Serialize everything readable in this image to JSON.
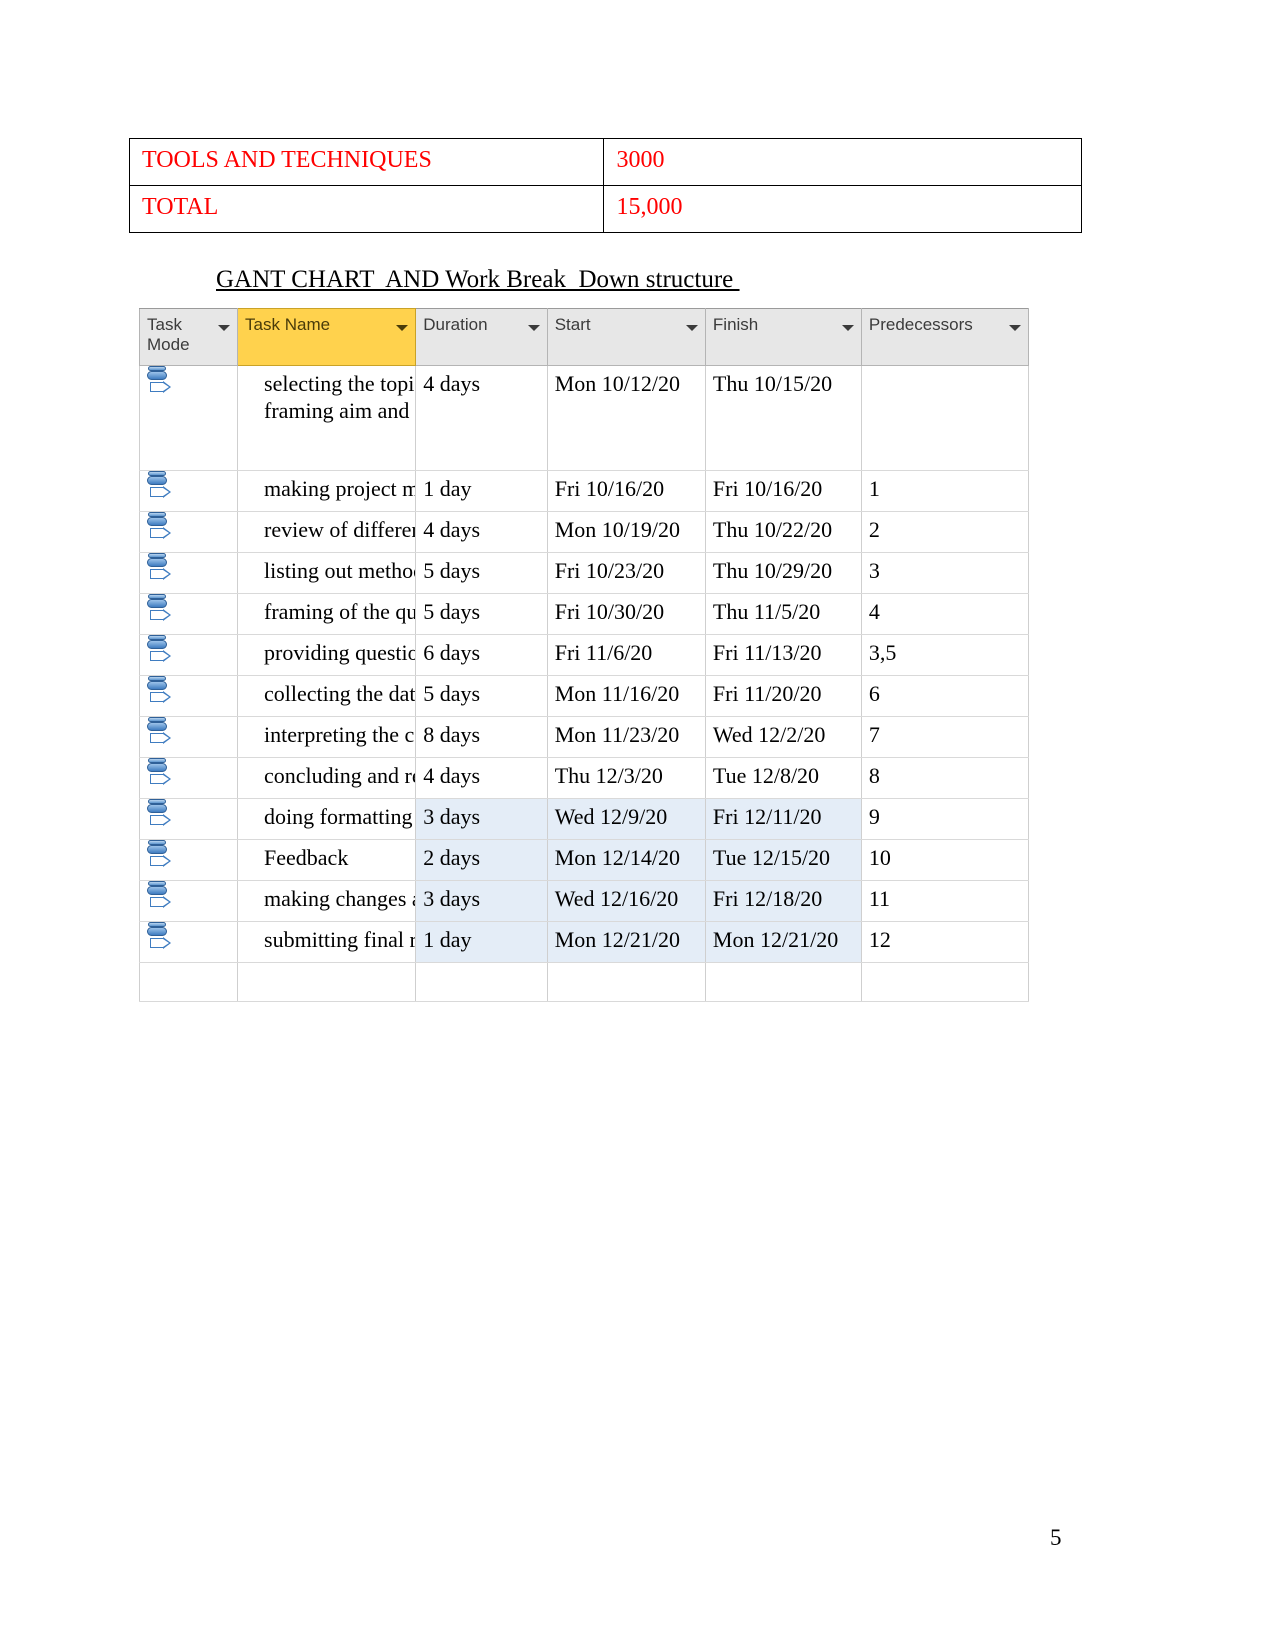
{
  "budget_table": {
    "rows": [
      {
        "label": "TOOLS AND TECHNIQUES",
        "value": "3000"
      },
      {
        "label": "TOTAL",
        "value": "15,000"
      }
    ],
    "text_color": "#ff0000",
    "border_color": "#000000"
  },
  "section_heading": "GANT CHART  AND Work Break  Down structure ",
  "gantt": {
    "accent_header_color": "#ffd24d",
    "header_color": "#e7e7e7",
    "selection_color": "#e4edf7",
    "columns": [
      {
        "key": "task_mode",
        "label": "Task Mode",
        "filter_icon": "chevron-down-icon",
        "highlighted": false
      },
      {
        "key": "task_name",
        "label": "Task Name",
        "filter_icon": "chevron-down-icon",
        "highlighted": true
      },
      {
        "key": "duration",
        "label": "Duration",
        "filter_icon": "chevron-down-icon",
        "highlighted": false
      },
      {
        "key": "start",
        "label": "Start",
        "filter_icon": "chevron-down-icon",
        "highlighted": false
      },
      {
        "key": "finish",
        "label": "Finish",
        "filter_icon": "chevron-down-icon",
        "highlighted": false
      },
      {
        "key": "predecessors",
        "label": "Predecessors",
        "filter_icon": "chevron-down-icon",
        "highlighted": false
      }
    ],
    "mode_icon_name": "auto-scheduled-task-icon",
    "rows": [
      {
        "mode_icon": "auto-scheduled-task-icon",
        "task_name": "selecting the topic and framing aim and objective",
        "duration": "4 days",
        "start": "Mon 10/12/20",
        "finish": "Thu 10/15/20",
        "predecessors": "",
        "selected": false,
        "wrapped": true
      },
      {
        "mode_icon": "auto-scheduled-task-icon",
        "task_name": "making project managemen",
        "duration": "1 day",
        "start": "Fri 10/16/20",
        "finish": "Fri 10/16/20",
        "predecessors": "1",
        "selected": false,
        "wrapped": false
      },
      {
        "mode_icon": "auto-scheduled-task-icon",
        "task_name": "review of different literatu",
        "duration": "4 days",
        "start": "Mon 10/19/20",
        "finish": "Thu 10/22/20",
        "predecessors": "2",
        "selected": false,
        "wrapped": false
      },
      {
        "mode_icon": "auto-scheduled-task-icon",
        "task_name": "listing out methods of rese",
        "duration": "5 days",
        "start": "Fri 10/23/20",
        "finish": "Thu 10/29/20",
        "predecessors": "3",
        "selected": false,
        "wrapped": false
      },
      {
        "mode_icon": "auto-scheduled-task-icon",
        "task_name": "framing of the questionnai",
        "duration": "5 days",
        "start": "Fri 10/30/20",
        "finish": "Thu 11/5/20",
        "predecessors": "4",
        "selected": false,
        "wrapped": false
      },
      {
        "mode_icon": "auto-scheduled-task-icon",
        "task_name": "providing questionnaire to",
        "duration": "6 days",
        "start": "Fri 11/6/20",
        "finish": "Fri 11/13/20",
        "predecessors": "3,5",
        "selected": false,
        "wrapped": false
      },
      {
        "mode_icon": "auto-scheduled-task-icon",
        "task_name": "collecting the data",
        "duration": "5 days",
        "start": "Mon 11/16/20",
        "finish": "Fri 11/20/20",
        "predecessors": "6",
        "selected": false,
        "wrapped": false
      },
      {
        "mode_icon": "auto-scheduled-task-icon",
        "task_name": "interpreting the collected",
        "duration": "8 days",
        "start": "Mon 11/23/20",
        "finish": "Wed 12/2/20",
        "predecessors": "7",
        "selected": false,
        "wrapped": false
      },
      {
        "mode_icon": "auto-scheduled-task-icon",
        "task_name": "concluding and recommen",
        "duration": "4 days",
        "start": "Thu 12/3/20",
        "finish": "Tue 12/8/20",
        "predecessors": "8",
        "selected": false,
        "wrapped": false
      },
      {
        "mode_icon": "auto-scheduled-task-icon",
        "task_name": "doing formatting",
        "duration": "3 days",
        "start": "Wed 12/9/20",
        "finish": "Fri 12/11/20",
        "predecessors": "9",
        "selected": true,
        "wrapped": false
      },
      {
        "mode_icon": "auto-scheduled-task-icon",
        "task_name": "Feedback",
        "duration": "2 days",
        "start": "Mon 12/14/20",
        "finish": "Tue 12/15/20",
        "predecessors": "10",
        "selected": true,
        "wrapped": false
      },
      {
        "mode_icon": "auto-scheduled-task-icon",
        "task_name": "making changes as per gi",
        "duration": "3 days",
        "start": "Wed 12/16/20",
        "finish": "Fri 12/18/20",
        "predecessors": "11",
        "selected": true,
        "wrapped": false
      },
      {
        "mode_icon": "auto-scheduled-task-icon",
        "task_name": "submitting final research",
        "duration": "1 day",
        "start": "Mon 12/21/20",
        "finish": "Mon 12/21/20",
        "predecessors": "12",
        "selected": true,
        "wrapped": false
      },
      {
        "mode_icon": "",
        "task_name": "",
        "duration": "",
        "start": "",
        "finish": "",
        "predecessors": "",
        "selected": false,
        "wrapped": false,
        "blank": true
      }
    ]
  },
  "page_number": "5"
}
